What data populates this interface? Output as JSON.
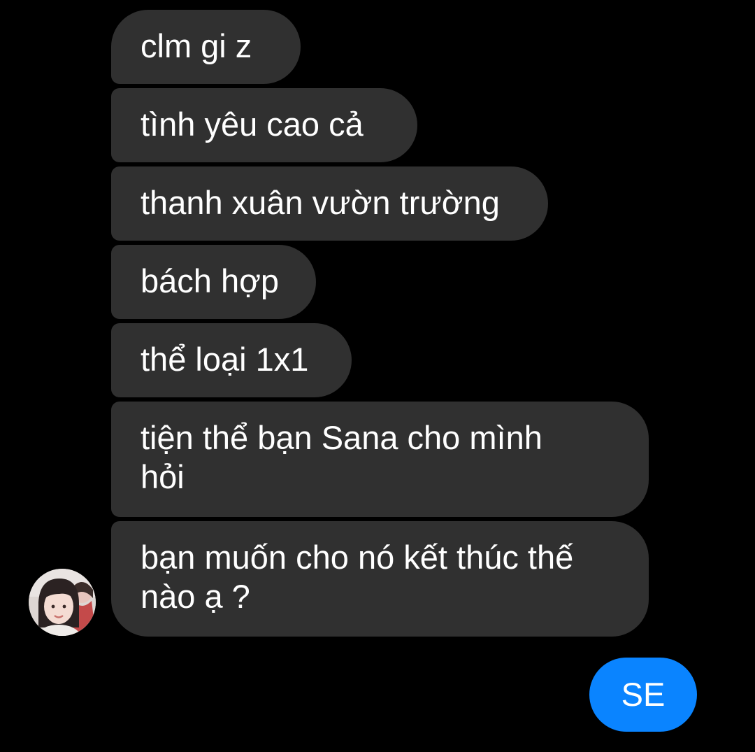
{
  "conversation": {
    "incoming": [
      {
        "text": "clm gi z"
      },
      {
        "text": "tình yêu cao cả"
      },
      {
        "text": "thanh xuân vườn trường"
      },
      {
        "text": "bách hợp"
      },
      {
        "text": "thể loại 1x1"
      },
      {
        "text": "tiện thể bạn Sana cho mình hỏi"
      },
      {
        "text": "bạn muốn cho nó kết thúc thế nào ạ ?"
      }
    ],
    "outgoing": [
      {
        "text": "SE"
      }
    ]
  },
  "colors": {
    "background": "#000000",
    "incoming_bubble": "#303030",
    "outgoing_bubble": "#0a84ff",
    "text": "#ffffff"
  },
  "icons": {
    "sender_avatar": "profile-photo-avatar"
  }
}
